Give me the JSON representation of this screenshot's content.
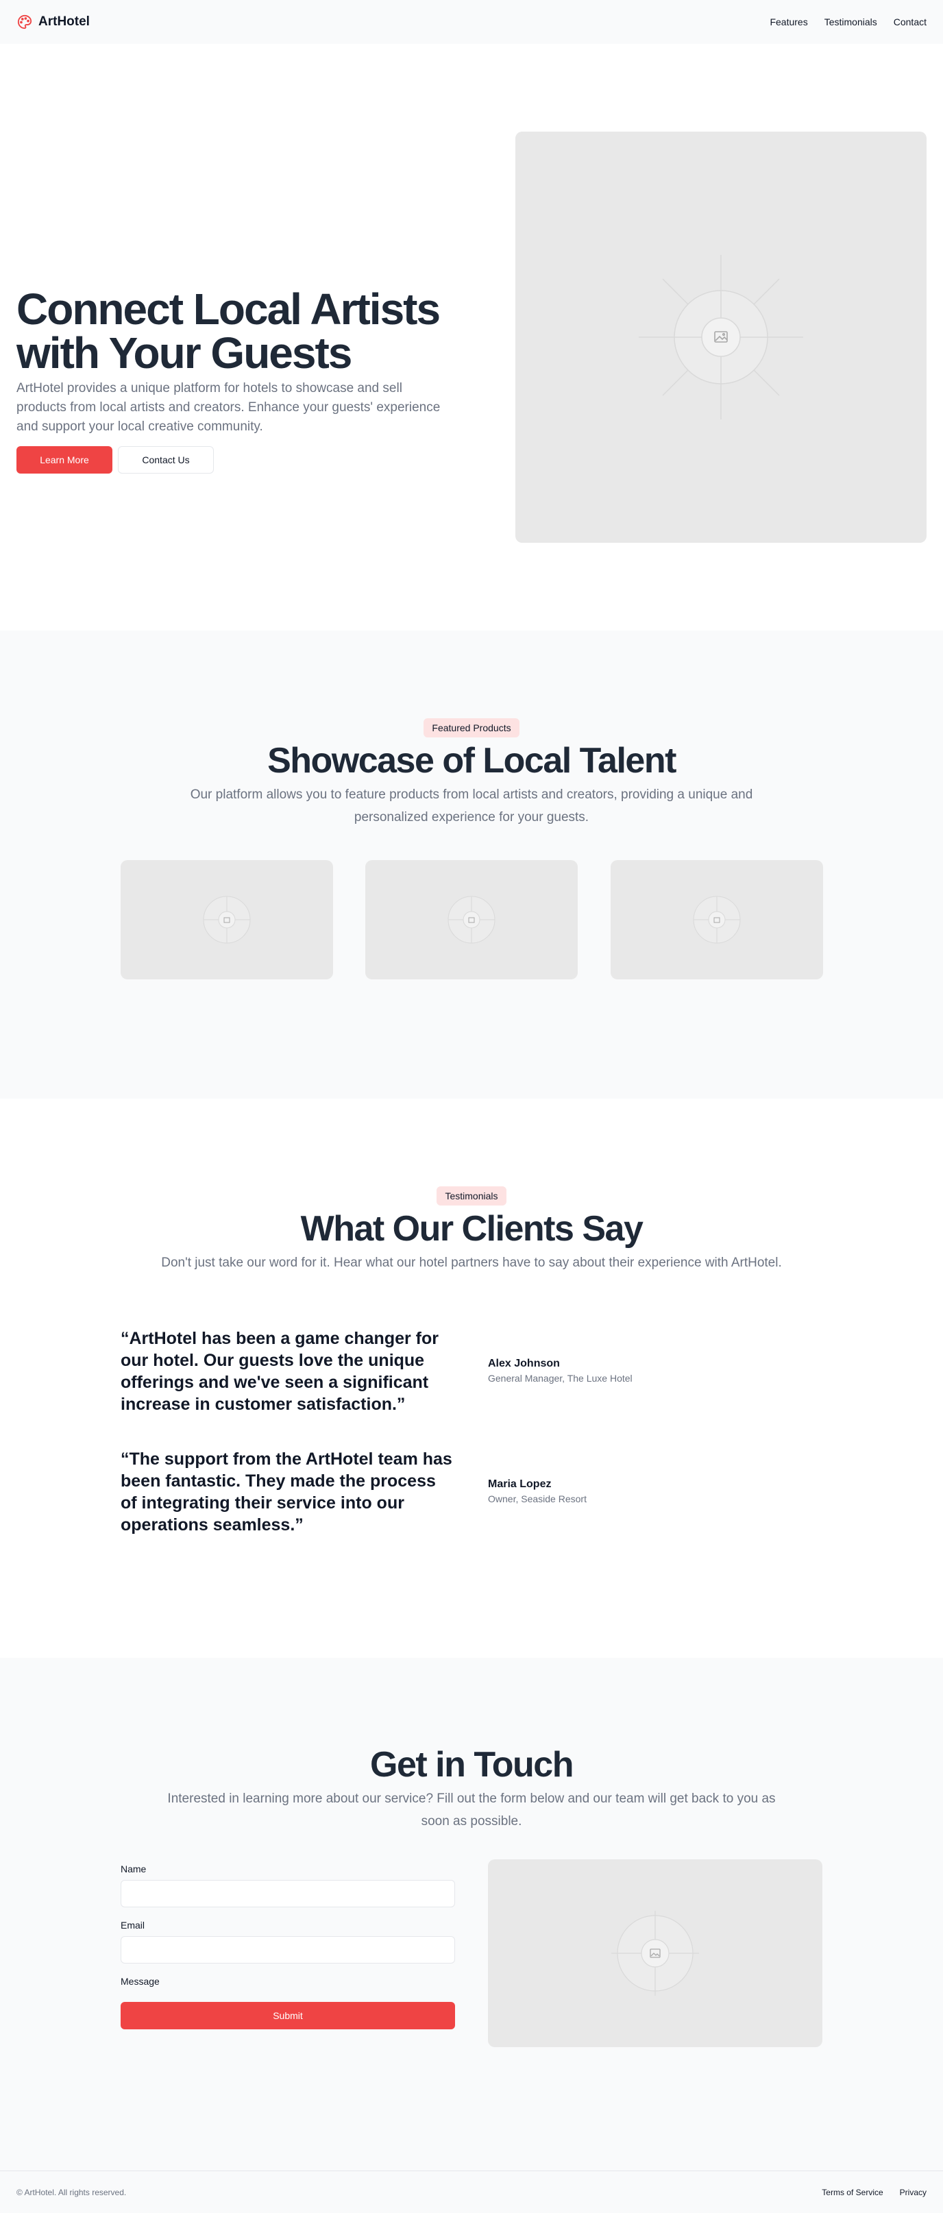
{
  "header": {
    "brand_name": "ArtHotel",
    "brand_icon": "palette-icon",
    "nav": [
      {
        "label": "Features"
      },
      {
        "label": "Testimonials"
      },
      {
        "label": "Contact"
      }
    ]
  },
  "hero": {
    "title_line1": "Connect Local Artists",
    "title_line2": "with Your Guests",
    "subtitle": "ArtHotel provides a unique platform for hotels to showcase and sell products from local artists and creators. Enhance your guests' experience and support your local creative community.",
    "primary_button": "Learn More",
    "secondary_button": "Contact Us",
    "image_icon": "image-placeholder-icon"
  },
  "products": {
    "badge": "Featured Products",
    "title": "Showcase of Local Talent",
    "subtitle": "Our platform allows you to feature products from local artists and creators, providing a unique and personalized experience for your guests."
  },
  "testimonials": {
    "badge": "Testimonials",
    "title": "What Our Clients Say",
    "subtitle": "Don't just take our word for it. Hear what our hotel partners have to say about their experience with ArtHotel.",
    "items": [
      {
        "quote": "“ArtHotel has been a game changer for our hotel. Our guests love the unique offerings and we've seen a significant increase in customer satisfaction.”",
        "name": "Alex Johnson",
        "role": "General Manager, The Luxe Hotel"
      },
      {
        "quote": "“The support from the ArtHotel team has been fantastic. They made the process of integrating their service into our operations seamless.”",
        "name": "Maria Lopez",
        "role": "Owner, Seaside Resort"
      }
    ]
  },
  "contact": {
    "title": "Get in Touch",
    "subtitle": "Interested in learning more about our service? Fill out the form below and our team will get back to you as soon as possible.",
    "name_label": "Name",
    "email_label": "Email",
    "message_label": "Message",
    "submit_label": "Submit"
  },
  "footer": {
    "copyright": "© ArtHotel. All rights reserved.",
    "links": [
      {
        "label": "Terms of Service"
      },
      {
        "label": "Privacy"
      }
    ]
  },
  "colors": {
    "accent": "#ef4444",
    "badge_bg": "#fde2e2",
    "heading": "#1f2937",
    "muted": "#6b7280",
    "section_gray": "#f9fafb"
  }
}
